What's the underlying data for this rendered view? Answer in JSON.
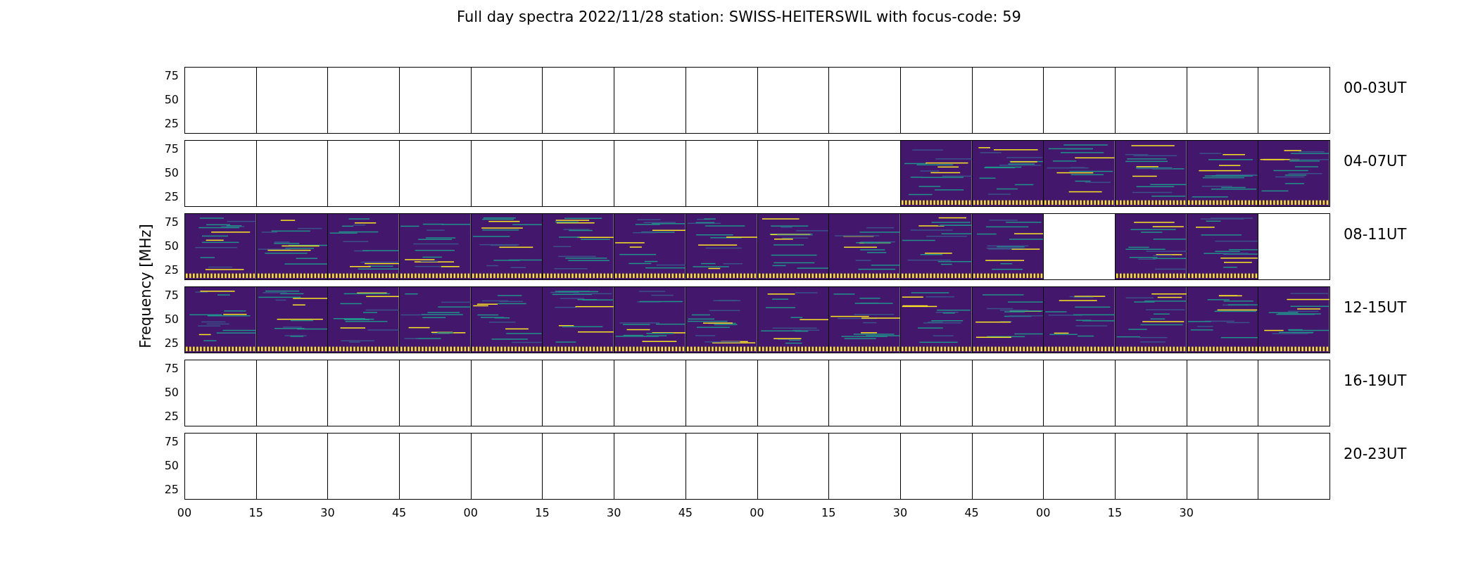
{
  "title": "Full day spectra 2022/11/28 station: SWISS-HEITERSWIL with focus-code: 59",
  "ylabel": "Frequency [MHz]",
  "rows": [
    {
      "label": "00-03UT",
      "yticks": [
        "75",
        "50",
        "25"
      ],
      "panels": [
        {
          "has_data": false
        },
        {
          "has_data": false
        },
        {
          "has_data": false
        },
        {
          "has_data": false
        },
        {
          "has_data": false
        },
        {
          "has_data": false
        },
        {
          "has_data": false
        },
        {
          "has_data": false
        },
        {
          "has_data": false
        },
        {
          "has_data": false
        },
        {
          "has_data": false
        },
        {
          "has_data": false
        },
        {
          "has_data": false
        },
        {
          "has_data": false
        },
        {
          "has_data": false
        },
        {
          "has_data": false
        }
      ]
    },
    {
      "label": "04-07UT",
      "yticks": [
        "75",
        "50",
        "25"
      ],
      "panels": [
        {
          "has_data": false
        },
        {
          "has_data": false
        },
        {
          "has_data": false
        },
        {
          "has_data": false
        },
        {
          "has_data": false
        },
        {
          "has_data": false
        },
        {
          "has_data": false
        },
        {
          "has_data": false
        },
        {
          "has_data": false
        },
        {
          "has_data": false
        },
        {
          "has_data": true
        },
        {
          "has_data": true
        },
        {
          "has_data": true
        },
        {
          "has_data": true
        },
        {
          "has_data": true
        },
        {
          "has_data": true
        }
      ]
    },
    {
      "label": "08-11UT",
      "yticks": [
        "75",
        "50",
        "25"
      ],
      "panels": [
        {
          "has_data": true
        },
        {
          "has_data": true
        },
        {
          "has_data": true
        },
        {
          "has_data": true
        },
        {
          "has_data": true
        },
        {
          "has_data": true
        },
        {
          "has_data": true
        },
        {
          "has_data": true
        },
        {
          "has_data": true
        },
        {
          "has_data": true
        },
        {
          "has_data": true
        },
        {
          "has_data": true
        },
        {
          "has_data": false
        },
        {
          "has_data": true
        },
        {
          "has_data": true
        },
        {
          "has_data": false
        }
      ]
    },
    {
      "label": "12-15UT",
      "yticks": [
        "75",
        "50",
        "25"
      ],
      "panels": [
        {
          "has_data": true
        },
        {
          "has_data": true
        },
        {
          "has_data": true
        },
        {
          "has_data": true
        },
        {
          "has_data": true
        },
        {
          "has_data": true
        },
        {
          "has_data": true
        },
        {
          "has_data": true
        },
        {
          "has_data": true
        },
        {
          "has_data": true
        },
        {
          "has_data": true
        },
        {
          "has_data": true
        },
        {
          "has_data": true
        },
        {
          "has_data": true
        },
        {
          "has_data": true
        },
        {
          "has_data": true
        }
      ]
    },
    {
      "label": "16-19UT",
      "yticks": [
        "75",
        "50",
        "25"
      ],
      "panels": [
        {
          "has_data": false
        },
        {
          "has_data": false
        },
        {
          "has_data": false
        },
        {
          "has_data": false
        },
        {
          "has_data": false
        },
        {
          "has_data": false
        },
        {
          "has_data": false
        },
        {
          "has_data": false
        },
        {
          "has_data": false
        },
        {
          "has_data": false
        },
        {
          "has_data": false
        },
        {
          "has_data": false
        },
        {
          "has_data": false
        },
        {
          "has_data": false
        },
        {
          "has_data": false
        },
        {
          "has_data": false
        }
      ]
    },
    {
      "label": "20-23UT",
      "yticks": [
        "75",
        "50",
        "25"
      ],
      "panels": [
        {
          "has_data": false
        },
        {
          "has_data": false
        },
        {
          "has_data": false
        },
        {
          "has_data": false
        },
        {
          "has_data": false
        },
        {
          "has_data": false
        },
        {
          "has_data": false
        },
        {
          "has_data": false
        },
        {
          "has_data": false
        },
        {
          "has_data": false
        },
        {
          "has_data": false
        },
        {
          "has_data": false
        },
        {
          "has_data": false
        },
        {
          "has_data": false
        },
        {
          "has_data": false
        },
        {
          "has_data": false
        }
      ]
    }
  ],
  "xticks": [
    "00",
    "15",
    "30",
    "45",
    "00",
    "15",
    "30",
    "45",
    "00",
    "15",
    "30",
    "45",
    "00",
    "15",
    "30"
  ]
}
